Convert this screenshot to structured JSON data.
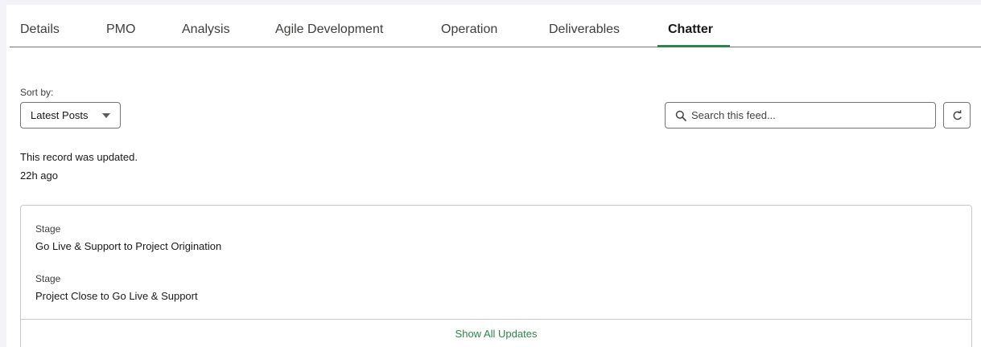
{
  "tabs": [
    {
      "label": "Details"
    },
    {
      "label": "PMO"
    },
    {
      "label": "Analysis"
    },
    {
      "label": "Agile Development"
    },
    {
      "label": "Operation"
    },
    {
      "label": "Deliverables"
    },
    {
      "label": "Chatter",
      "active": true
    }
  ],
  "sort": {
    "label": "Sort by:",
    "selected": "Latest Posts"
  },
  "search": {
    "placeholder": "Search this feed..."
  },
  "feed": {
    "message": "This record was updated.",
    "timestamp": "22h ago",
    "changes": [
      {
        "field": "Stage",
        "value": "Go Live & Support to Project Origination"
      },
      {
        "field": "Stage",
        "value": "Project Close to Go Live & Support"
      }
    ],
    "show_all_label": "Show All Updates"
  },
  "colors": {
    "accent": "#2e844a",
    "border": "#747474"
  },
  "icons": {
    "search": "search-icon",
    "refresh": "refresh-icon",
    "dropdown": "caret-down-icon"
  }
}
